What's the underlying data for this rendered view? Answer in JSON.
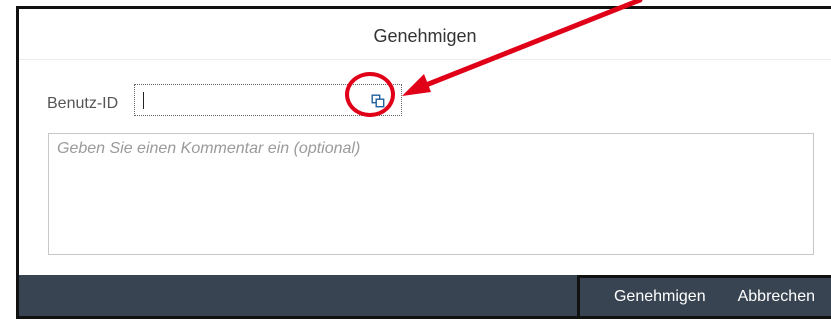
{
  "dialog": {
    "title": "Genehmigen",
    "user_field": {
      "label": "Benutz-ID",
      "value": "",
      "value_help_icon": "value-help-icon"
    },
    "comment": {
      "placeholder": "Geben Sie einen Kommentar ein (optional)"
    },
    "footer": {
      "approve_label": "Genehmigen",
      "cancel_label": "Abbrechen"
    }
  },
  "colors": {
    "annotation": "#e00018",
    "footer": "#394452",
    "link_icon": "#1f5f9f"
  }
}
